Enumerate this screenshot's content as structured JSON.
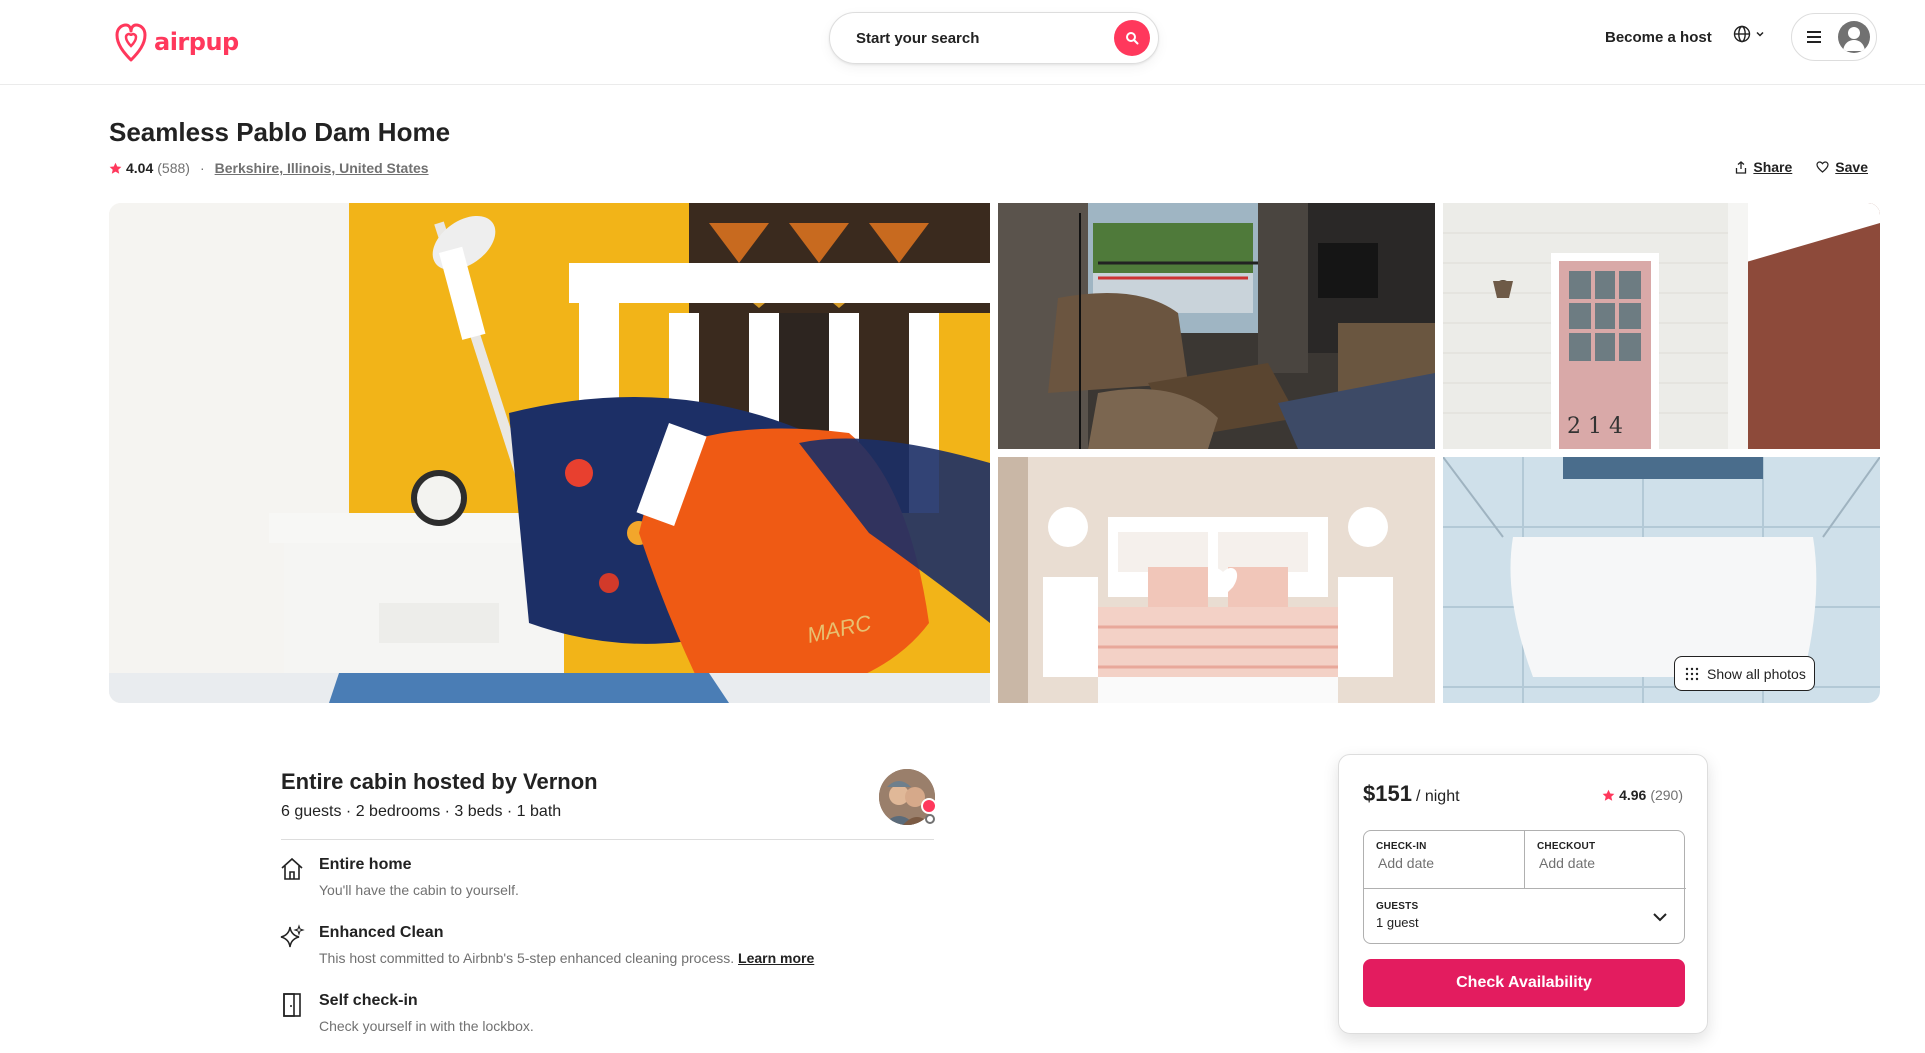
{
  "header": {
    "logo_text": "airpup",
    "search_placeholder": "Start your search",
    "become_host": "Become a host",
    "brand_color": "#ff385c"
  },
  "listing": {
    "title": "Seamless Pablo Dam Home",
    "rating": "4.04",
    "reviews": "(588)",
    "location": "Berkshire, Illinois, United States",
    "share_label": "Share",
    "save_label": "Save"
  },
  "gallery": {
    "photos": [
      "bedroom-pillows",
      "living-room",
      "pink-door",
      "pink-bedroom",
      "shower"
    ],
    "show_all_label": "Show all photos"
  },
  "host": {
    "title": "Entire cabin hosted by Vernon",
    "subtitle": "6 guests · 2 bedrooms · 3 beds · 1 bath"
  },
  "features": [
    {
      "icon": "home-icon",
      "title": "Entire home",
      "desc": "You'll have the cabin to yourself."
    },
    {
      "icon": "sparkle-icon",
      "title": "Enhanced Clean",
      "desc": "This host committed to Airbnb's 5-step enhanced cleaning process.",
      "link": "Learn more"
    },
    {
      "icon": "door-icon",
      "title": "Self check-in",
      "desc": "Check yourself in with the lockbox."
    }
  ],
  "booking": {
    "price": "$151",
    "per_night": "/ night",
    "rating": "4.96",
    "reviews": "(290)",
    "checkin_label": "CHECK-IN",
    "checkin_value": "Add date",
    "checkout_label": "CHECKOUT",
    "checkout_value": "Add date",
    "guests_label": "GUESTS",
    "guests_value": "1 guest",
    "button_label": "Check Availability",
    "button_color": "#e31c5f"
  }
}
